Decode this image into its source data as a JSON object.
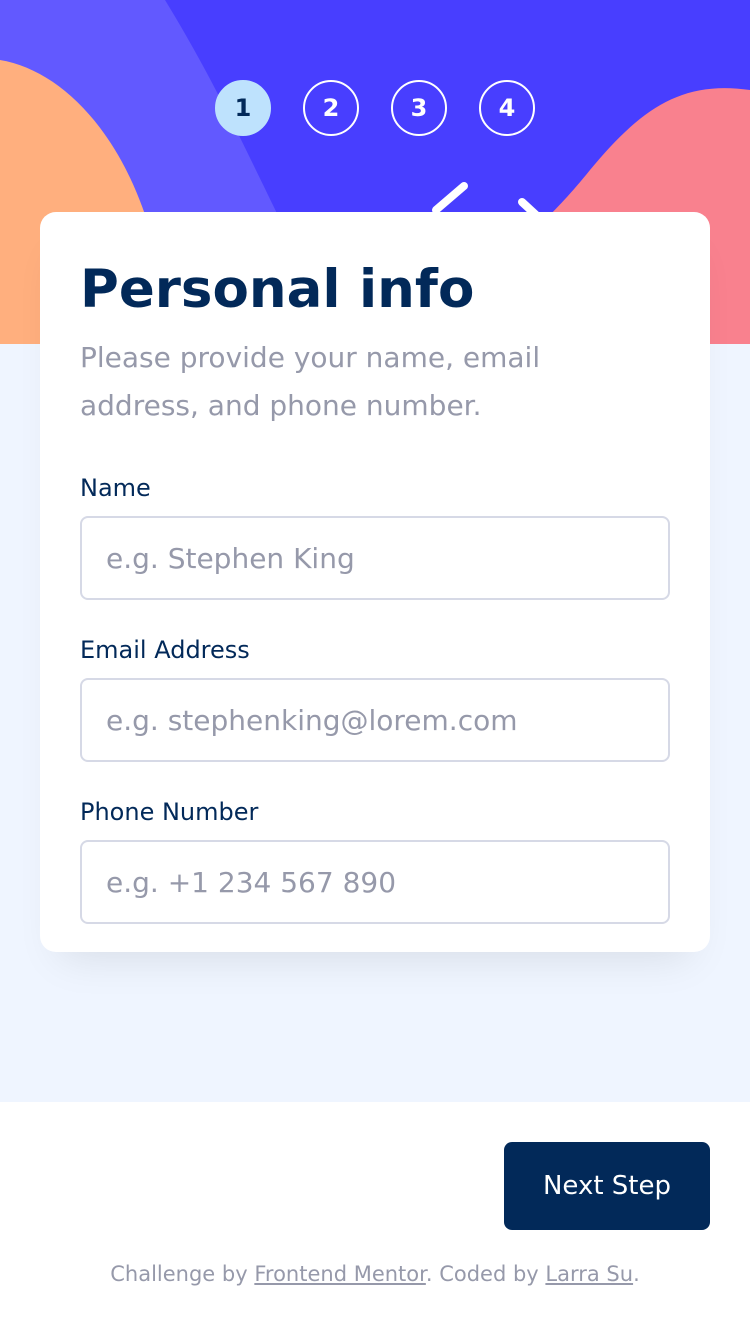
{
  "colors": {
    "header_blue": "#483eff",
    "header_purple": "#6259ff",
    "orange_blob": "#ffaf7e",
    "pink_blob": "#f9818e",
    "step_active_bg": "#bee2fd",
    "marine_blue": "#022959",
    "grey_text": "#9699aa",
    "border": "#d6d9e6",
    "page_bg": "#eff5ff"
  },
  "steps": [
    {
      "number": "1",
      "active": true
    },
    {
      "number": "2",
      "active": false
    },
    {
      "number": "3",
      "active": false
    },
    {
      "number": "4",
      "active": false
    }
  ],
  "form": {
    "title": "Personal info",
    "subtitle": "Please provide your name, email address, and phone number.",
    "name": {
      "label": "Name",
      "placeholder": "e.g. Stephen King",
      "value": ""
    },
    "email": {
      "label": "Email Address",
      "placeholder": "e.g. stephenking@lorem.com",
      "value": ""
    },
    "phone": {
      "label": "Phone Number",
      "placeholder": "e.g. +1 234 567 890",
      "value": ""
    }
  },
  "footer": {
    "next_label": "Next Step",
    "attribution": {
      "prefix": "Challenge by ",
      "link1": "Frontend Mentor",
      "middle": ". Coded by ",
      "link2": "Larra Su",
      "suffix": "."
    }
  }
}
